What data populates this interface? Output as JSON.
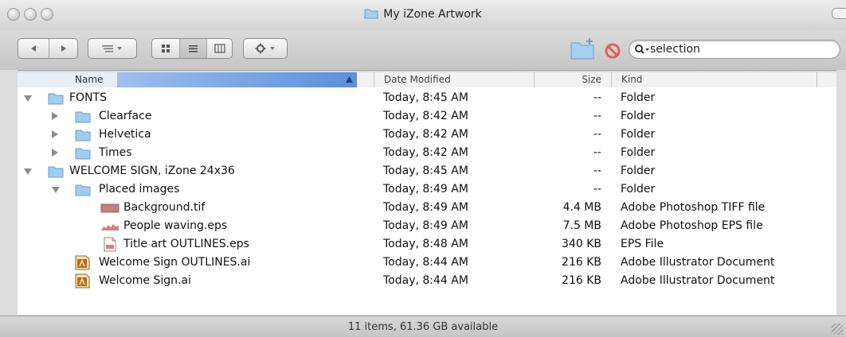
{
  "window": {
    "title": "My iZone Artwork"
  },
  "toolbar": {
    "back_icon": "left-arrow-icon",
    "forward_icon": "right-arrow-icon",
    "search_placeholder": "",
    "search_value": "selection"
  },
  "columns": {
    "name": "Name",
    "date": "Date Modified",
    "size": "Size",
    "kind": "Kind"
  },
  "rows": [
    {
      "name": "FONTS",
      "date": "Today, 8:45 AM",
      "size": "--",
      "kind": "Folder"
    },
    {
      "name": "Clearface",
      "date": "Today, 8:42 AM",
      "size": "--",
      "kind": "Folder"
    },
    {
      "name": "Helvetica",
      "date": "Today, 8:42 AM",
      "size": "--",
      "kind": "Folder"
    },
    {
      "name": "Times",
      "date": "Today, 8:42 AM",
      "size": "--",
      "kind": "Folder"
    },
    {
      "name": "WELCOME SIGN, iZone 24x36",
      "date": "Today, 8:45 AM",
      "size": "--",
      "kind": "Folder"
    },
    {
      "name": "Placed images",
      "date": "Today, 8:49 AM",
      "size": "--",
      "kind": "Folder"
    },
    {
      "name": "Background.tif",
      "date": "Today, 8:49 AM",
      "size": "4.4 MB",
      "kind": "Adobe Photoshop TIFF file"
    },
    {
      "name": "People waving.eps",
      "date": "Today, 8:49 AM",
      "size": "7.5 MB",
      "kind": "Adobe Photoshop EPS file"
    },
    {
      "name": "Title art OUTLINES.eps",
      "date": "Today, 8:48 AM",
      "size": "340 KB",
      "kind": "EPS File"
    },
    {
      "name": "Welcome Sign OUTLINES.ai",
      "date": "Today, 8:44 AM",
      "size": "216 KB",
      "kind": "Adobe Illustrator Document"
    },
    {
      "name": "Welcome Sign.ai",
      "date": "Today, 8:44 AM",
      "size": "216 KB",
      "kind": "Adobe Illustrator Document"
    }
  ],
  "status": {
    "text": "11 items, 61.36 GB available"
  },
  "colors": {
    "sort_header": "#5a8fdc",
    "folder": "#8fc3ee"
  }
}
